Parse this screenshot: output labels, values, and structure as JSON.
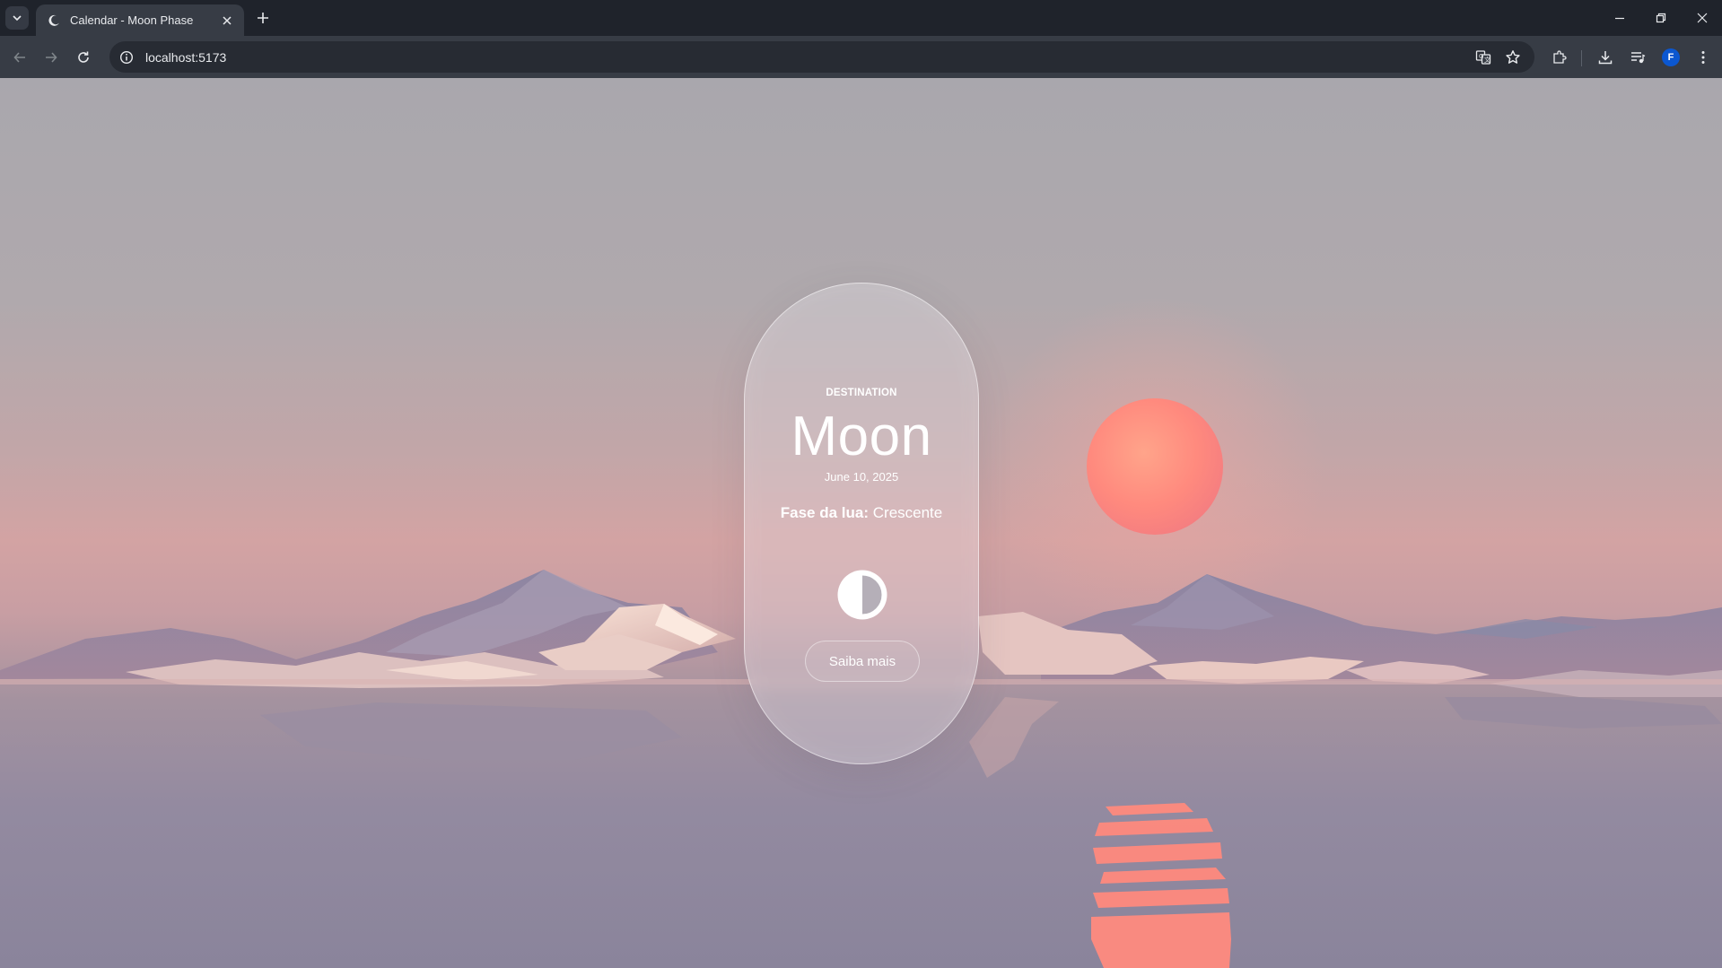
{
  "browser": {
    "tab": {
      "title": "Calendar - Moon Phase"
    },
    "url": "localhost:5173",
    "profile_initial": "F"
  },
  "card": {
    "eyebrow": "DESTINATION",
    "title": "Moon",
    "date": "June 10, 2025",
    "phase_label": "Fase da lua:",
    "phase_value": "Crescente",
    "button_label": "Saiba mais"
  },
  "colors": {
    "sun": "#ff8a7e",
    "sky_top": "#a9a7ad",
    "horizon": "#d3a3a3",
    "water": "#8a849b"
  },
  "icons": {
    "tab_favicon": "moon-icon",
    "phase_icon": "half-moon-icon"
  }
}
